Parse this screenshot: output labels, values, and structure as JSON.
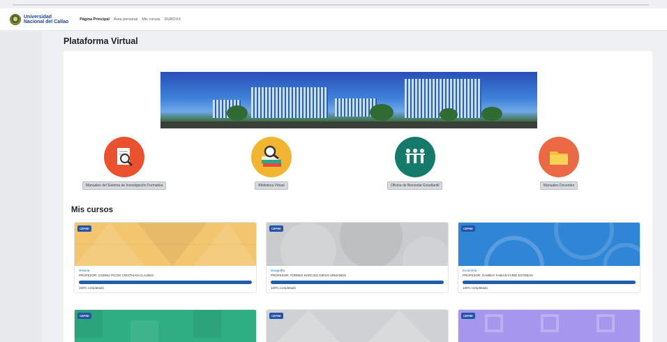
{
  "navbar": {
    "logo_line1": "Universidad",
    "logo_line2": "Nacional del Callao",
    "links": [
      "Página Principal",
      "Área personal",
      "Mis cursos",
      "DUROXX"
    ]
  },
  "page": {
    "title": "Plataforma Virtual"
  },
  "quick_links": [
    {
      "label": "Manuales del Sistema de Investigación Formativa",
      "icon": "document-search-icon",
      "color": "#e9512f"
    },
    {
      "label": "Biblioteca Virtual",
      "icon": "books-search-icon",
      "color": "#f2b531"
    },
    {
      "label": "Oficina de Bienestar Estudiantil",
      "icon": "people-icon",
      "color": "#167a6a"
    },
    {
      "label": "Manuales Docentes",
      "icon": "folder-icon",
      "color": "#ea6a46"
    }
  ],
  "section": {
    "my_courses": "Mis cursos"
  },
  "courses": [
    {
      "badge": "CEPRE",
      "category": "Historia",
      "name": "PROFESOR: CODINA PICOS Cristhian Claudio",
      "progress": "100% completado",
      "color": "#f3c56f"
    },
    {
      "badge": "CEPRE",
      "category": "Geografía",
      "name": "PROFESOR: TORRES NARCISO DIEGO ARMANDO",
      "progress": "100% completado",
      "color": "#c9cbce"
    },
    {
      "badge": "CEPRE",
      "category": "Economía",
      "name": "PROFESOR: GAMBAY FABIAN FARID ESTEBAN",
      "progress": "100% completado",
      "color": "#2f85d6"
    },
    {
      "badge": "CEPRE",
      "color": "#2fae83"
    },
    {
      "badge": "CEPRE",
      "color": "#cfd1d4"
    },
    {
      "badge": "CEPRE",
      "color": "#a796ee"
    }
  ]
}
